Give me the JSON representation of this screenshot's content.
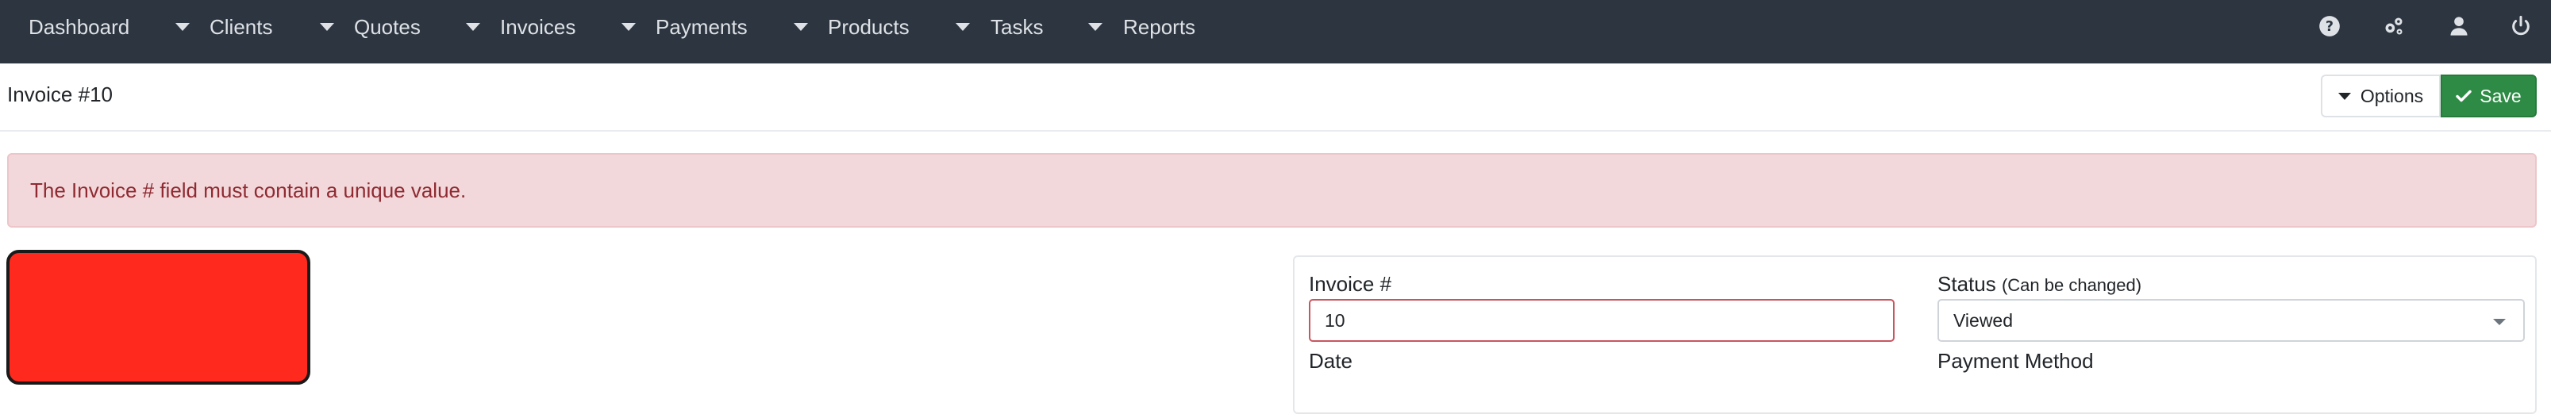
{
  "nav": {
    "items": [
      {
        "label": "Dashboard"
      },
      {
        "label": "Clients"
      },
      {
        "label": "Quotes"
      },
      {
        "label": "Invoices"
      },
      {
        "label": "Payments"
      },
      {
        "label": "Products"
      },
      {
        "label": "Tasks"
      },
      {
        "label": "Reports"
      }
    ],
    "icons": [
      "help-icon",
      "settings-icon",
      "user-icon",
      "power-icon"
    ]
  },
  "header": {
    "title": "Invoice #10",
    "options_label": "Options",
    "save_label": "Save"
  },
  "alert": {
    "message": "The Invoice # field must contain a unique value."
  },
  "form": {
    "invoice_number": {
      "label": "Invoice #",
      "value": "10"
    },
    "status": {
      "label": "Status",
      "hint": "(Can be changed)",
      "value": "Viewed"
    },
    "date": {
      "label": "Date"
    },
    "payment_method": {
      "label": "Payment Method"
    }
  },
  "colors": {
    "navbar": "#2d3540",
    "save_button": "#2e8b45",
    "alert_bg": "#f2d8da",
    "alert_text": "#8f2a32",
    "logo_placeholder": "#ff2a1d"
  }
}
